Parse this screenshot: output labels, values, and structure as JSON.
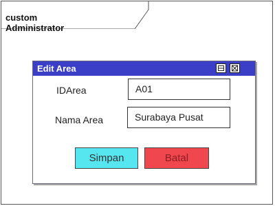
{
  "frame": {
    "title": "custom Administrator"
  },
  "dialog": {
    "title": "Edit Area",
    "minimize_icon": "minimize-icon",
    "close_icon": "close-icon",
    "fields": [
      {
        "label": "IDArea",
        "value": "A01"
      },
      {
        "label": "Nama Area",
        "value": "Surabaya Pusat"
      }
    ],
    "buttons": {
      "save_label": "Simpan",
      "cancel_label": "Batal"
    }
  },
  "colors": {
    "titlebar": "#3b3fc8",
    "save_button": "#55e6f0",
    "cancel_button": "#f0474f"
  }
}
